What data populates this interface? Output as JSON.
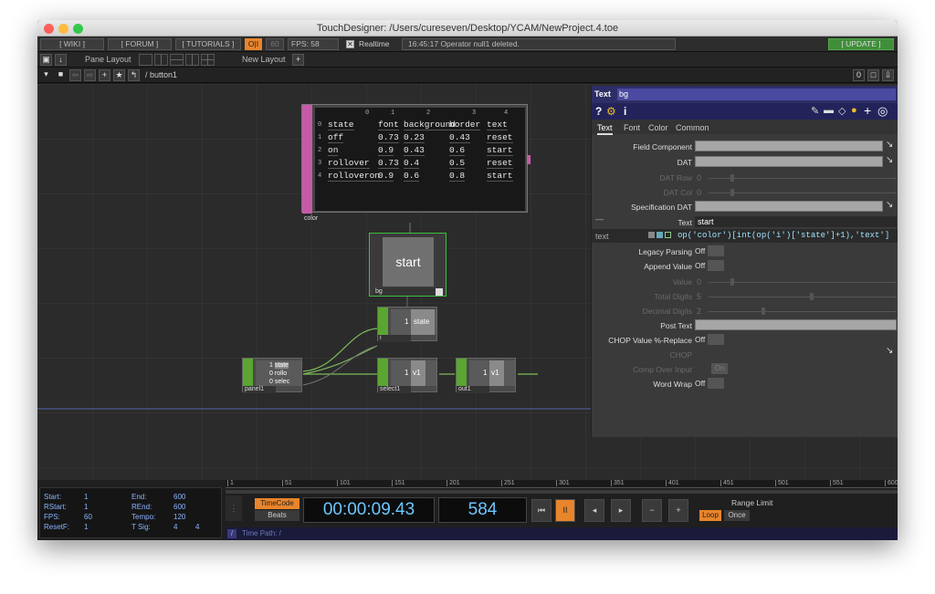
{
  "window": {
    "title": "TouchDesigner: /Users/cureseven/Desktop/YCAM/NewProject.4.toe"
  },
  "toolbar": {
    "wiki": "[ WIKI ]",
    "forum": "[ FORUM ]",
    "tutorials": "[ TUTORIALS ]",
    "oi": "O|I",
    "fps_target": "60",
    "fps": "FPS: 58",
    "realtime": "Realtime",
    "status": "16:45:17 Operator null1 deleted.",
    "update": "[ UPDATE ]",
    "pane_layout": "Pane Layout",
    "new_layout": "New Layout",
    "path": "/ button1",
    "pane_index": "0"
  },
  "colors": {
    "accent": "#e8852b",
    "panel_op": "#5aa630",
    "dat_op": "#c65aa8",
    "timecode": "#6ec6ff"
  },
  "table": {
    "name": "color",
    "col_index": [
      "0",
      "1",
      "2",
      "3",
      "4"
    ],
    "row_index": [
      "0",
      "1",
      "2",
      "3",
      "4"
    ],
    "rows": [
      [
        "state",
        "font",
        "background",
        "border",
        "text"
      ],
      [
        "off",
        "0.73",
        "0.23",
        "0.43",
        "reset"
      ],
      [
        "on",
        "0.9",
        "0.43",
        "0.6",
        "start"
      ],
      [
        "rollover",
        "0.73",
        "0.4",
        "0.5",
        "reset"
      ],
      [
        "rolloveron",
        "0.9",
        "0.6",
        "0.8",
        "start"
      ]
    ]
  },
  "nodes": {
    "bg": {
      "label": "bg",
      "preview": "start"
    },
    "i": {
      "label": "i",
      "value": "1",
      "channel": "state"
    },
    "panel1": {
      "label": "panel1",
      "lines": [
        [
          "1",
          "state"
        ],
        [
          "0",
          "rollo"
        ],
        [
          "0",
          "selec"
        ]
      ]
    },
    "select1": {
      "label": "select1",
      "value": "1",
      "channel": "v1"
    },
    "out1": {
      "label": "out1",
      "value": "1",
      "channel": "v1"
    }
  },
  "params": {
    "op_type": "Text",
    "op_name": "bg",
    "tabs": [
      "Text",
      "Font",
      "Color",
      "Common"
    ],
    "field_component": "Field Component",
    "dat": "DAT",
    "dat_row": "DAT Row",
    "dat_row_val": "0",
    "dat_col": "DAT Col",
    "dat_col_val": "0",
    "spec_dat": "Specification DAT",
    "text_label": "Text",
    "text_value": "start",
    "expr_label": "text",
    "expr": "op('color')[int(op('i')['state']+1),'text']",
    "legacy": "Legacy Parsing",
    "legacy_val": "Off",
    "append": "Append Value",
    "append_val": "Off",
    "value": "Value",
    "value_val": "0",
    "total_digits": "Total Digits",
    "total_digits_val": "5",
    "decimal_digits": "Decimal Digits",
    "decimal_digits_val": "2",
    "post_text": "Post Text",
    "chop_replace": "CHOP Value %-Replace",
    "chop_replace_val": "Off",
    "chop": "CHOP",
    "comp_over": "Comp Over Input",
    "comp_over_val": "On",
    "word_wrap": "Word Wrap",
    "word_wrap_val": "Off"
  },
  "timeline": {
    "ruler": [
      "1",
      "51",
      "101",
      "151",
      "201",
      "251",
      "301",
      "351",
      "401",
      "451",
      "501",
      "551",
      "600"
    ],
    "info": {
      "start_l": "Start:",
      "start": "1",
      "end_l": "End:",
      "end": "600",
      "rstart_l": "RStart:",
      "rstart": "1",
      "rend_l": "REnd:",
      "rend": "600",
      "fps_l": "FPS:",
      "fps": "60",
      "tempo_l": "Tempo:",
      "tempo": "120",
      "resetf_l": "ResetF:",
      "resetf": "1",
      "tsig_l": "T Sig:",
      "tsig_a": "4",
      "tsig_b": "4"
    },
    "timecode_btn": "TimeCode",
    "beats_btn": "Beats",
    "timecode": "00:00:09.43",
    "frame": "584",
    "range_limit": "Range Limit",
    "loop": "Loop",
    "once": "Once",
    "time_path": "Time Path: /",
    "slash": "/"
  }
}
